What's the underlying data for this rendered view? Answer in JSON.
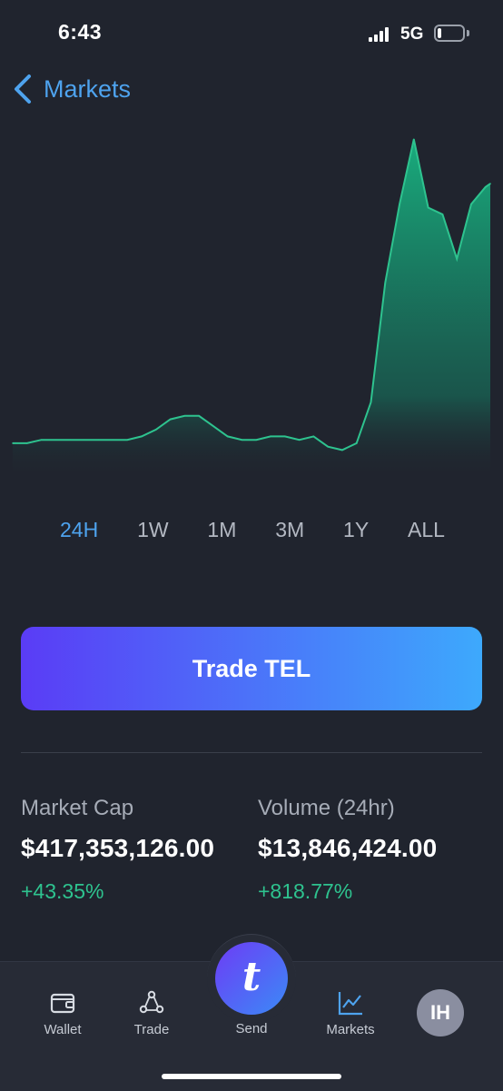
{
  "status": {
    "time": "6:43",
    "network": "5G",
    "battery_level": 0.15
  },
  "nav": {
    "back_label": "Markets"
  },
  "chart_data": {
    "type": "area",
    "title": "",
    "xlabel": "",
    "ylabel": "",
    "line_color": "#2ec38f",
    "fill_color": "#17a47a",
    "x": [
      0,
      3,
      6,
      9,
      12,
      15,
      18,
      21,
      24,
      27,
      30,
      33,
      36,
      39,
      42,
      45,
      48,
      51,
      54,
      57,
      60,
      63,
      66,
      69,
      72,
      75,
      78,
      81,
      84,
      87,
      90,
      93,
      96,
      99,
      100
    ],
    "values": [
      0.08,
      0.08,
      0.09,
      0.09,
      0.09,
      0.09,
      0.09,
      0.09,
      0.09,
      0.1,
      0.12,
      0.15,
      0.16,
      0.16,
      0.13,
      0.1,
      0.09,
      0.09,
      0.1,
      0.1,
      0.09,
      0.1,
      0.07,
      0.06,
      0.08,
      0.2,
      0.55,
      0.78,
      0.97,
      0.77,
      0.75,
      0.62,
      0.78,
      0.83,
      0.84
    ],
    "ranges": [
      "24H",
      "1W",
      "1M",
      "3M",
      "1Y",
      "ALL"
    ],
    "selected_range": "24H"
  },
  "actions": {
    "trade_label": "Trade TEL"
  },
  "stats": {
    "market_cap": {
      "label": "Market Cap",
      "value": "$417,353,126.00",
      "change": "+43.35%"
    },
    "volume": {
      "label": "Volume (24hr)",
      "value": "$13,846,424.00",
      "change": "+818.77%"
    }
  },
  "tabs": {
    "wallet": "Wallet",
    "trade": "Trade",
    "send": "Send",
    "send_glyph": "t",
    "markets": "Markets",
    "profile_initials": "IH",
    "active": "Markets"
  },
  "colors": {
    "accent": "#4ea3ee",
    "positive": "#2ec38f",
    "background": "#20242e"
  }
}
